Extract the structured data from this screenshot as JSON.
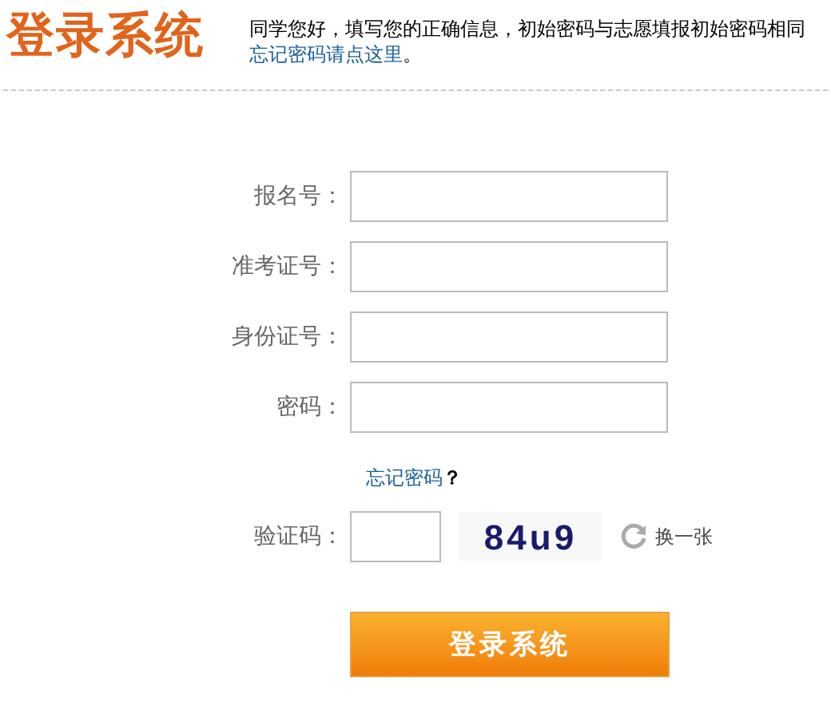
{
  "header": {
    "logo": "登录系统",
    "intro": "同学您好，填写您的正确信息，初始密码与志愿填报初始密码相同",
    "intro_link": "忘记密码请点这里",
    "intro_end": "。"
  },
  "fields": [
    {
      "label": "报名号："
    },
    {
      "label": "准考证号："
    },
    {
      "label": "身份证号："
    },
    {
      "label": "密码："
    }
  ],
  "forgot": {
    "link": "忘记密码",
    "mark": "？"
  },
  "captcha": {
    "label": "验证码：",
    "code": "84u9",
    "refresh": "换一张"
  },
  "submit": "登录系统"
}
